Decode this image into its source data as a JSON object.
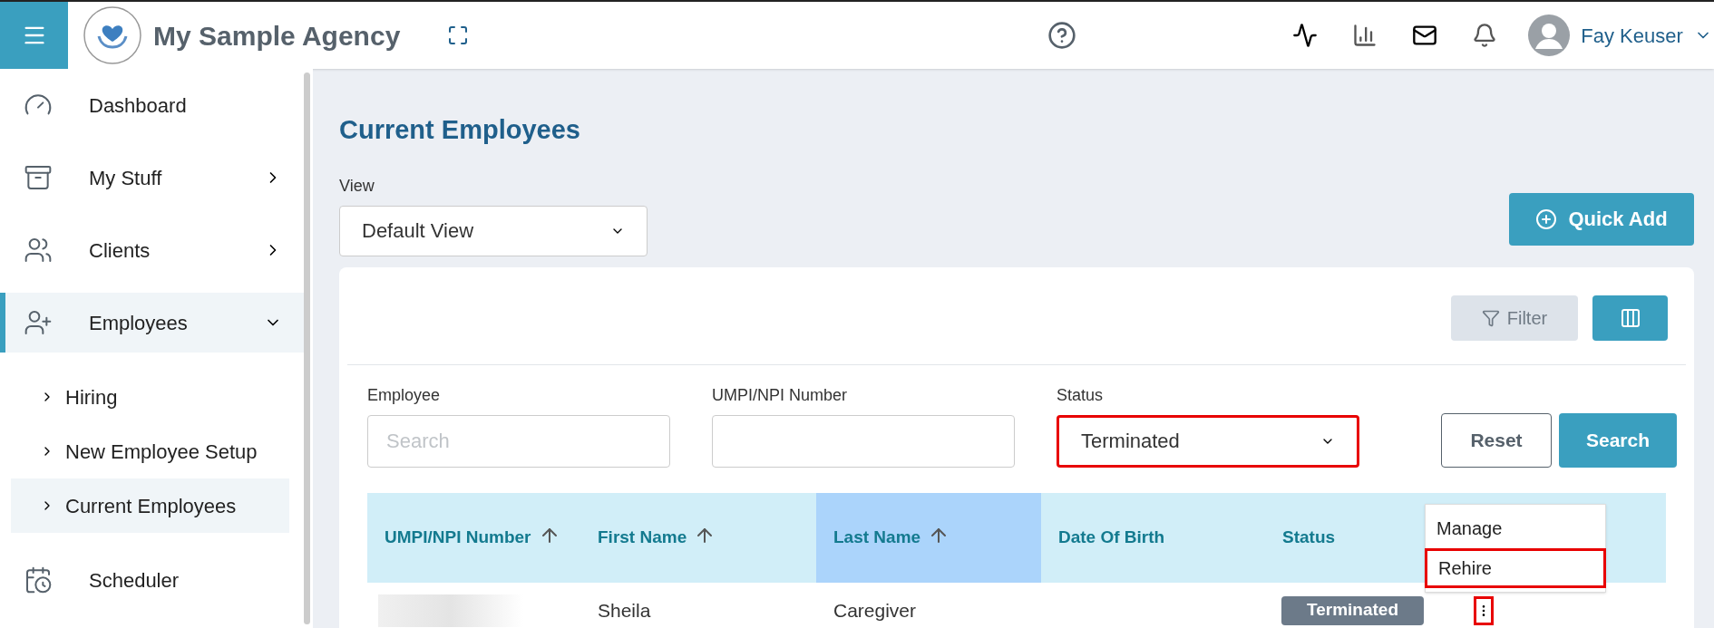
{
  "header": {
    "agency_name": "My Sample Agency",
    "user_name": "Fay Keuser"
  },
  "sidebar": {
    "items": [
      {
        "label": "Dashboard",
        "selected": false
      },
      {
        "label": "My Stuff",
        "selected": false,
        "expanded": false
      },
      {
        "label": "Clients",
        "selected": false,
        "expanded": false
      },
      {
        "label": "Employees",
        "selected": true,
        "expanded": true,
        "children": [
          {
            "label": "Hiring",
            "selected": false
          },
          {
            "label": "New Employee Setup",
            "selected": false
          },
          {
            "label": "Current Employees",
            "selected": true
          }
        ]
      },
      {
        "label": "Scheduler",
        "selected": false
      }
    ]
  },
  "page": {
    "title": "Current Employees",
    "view_label": "View",
    "view_value": "Default View",
    "quick_add": "Quick Add"
  },
  "toolbar": {
    "filter": "Filter"
  },
  "filters": [
    {
      "label": "Employee",
      "kind": "text",
      "placeholder": "Search",
      "highlighted": false
    },
    {
      "label": "UMPI/NPI Number",
      "kind": "text",
      "highlighted": false
    },
    {
      "label": "Status",
      "kind": "select",
      "value": "Terminated",
      "highlighted": true
    }
  ],
  "buttons": {
    "reset": "Reset",
    "search": "Search"
  },
  "table": {
    "columns": [
      {
        "label": "UMPI/NPI Number",
        "sortable": true,
        "selected": false
      },
      {
        "label": "First Name",
        "sortable": true,
        "selected": false
      },
      {
        "label": "Last Name",
        "sortable": true,
        "selected": true
      },
      {
        "label": "Date Of Birth",
        "sortable": false,
        "selected": false
      },
      {
        "label": "Status",
        "sortable": false,
        "selected": false
      }
    ],
    "rows": [
      {
        "first_name": "Sheila",
        "last_name": "Caregiver",
        "status": "Terminated",
        "actions_highlighted": true
      }
    ]
  },
  "actions_menu": {
    "items": [
      {
        "label": "Manage",
        "highlighted": false
      },
      {
        "label": "Rehire",
        "highlighted": true
      }
    ]
  }
}
